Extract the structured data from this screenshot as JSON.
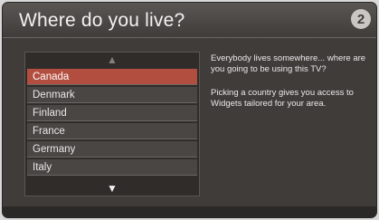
{
  "title": "Where do you live?",
  "step_number": "2",
  "list": {
    "scroll_up_glyph": "▲",
    "scroll_down_glyph": "▼",
    "items": [
      {
        "label": "Canada",
        "selected": true
      },
      {
        "label": "Denmark",
        "selected": false
      },
      {
        "label": "Finland",
        "selected": false
      },
      {
        "label": "France",
        "selected": false
      },
      {
        "label": "Germany",
        "selected": false
      },
      {
        "label": "Italy",
        "selected": false
      }
    ]
  },
  "description": {
    "p1": "Everybody lives somewhere... where are you going to be using this TV?",
    "p2": "Picking a country gives you access to Widgets tailored for your area."
  },
  "colors": {
    "background": "#3f3c3a",
    "selected_row": "#b24e3f",
    "row": "#4a4644"
  }
}
